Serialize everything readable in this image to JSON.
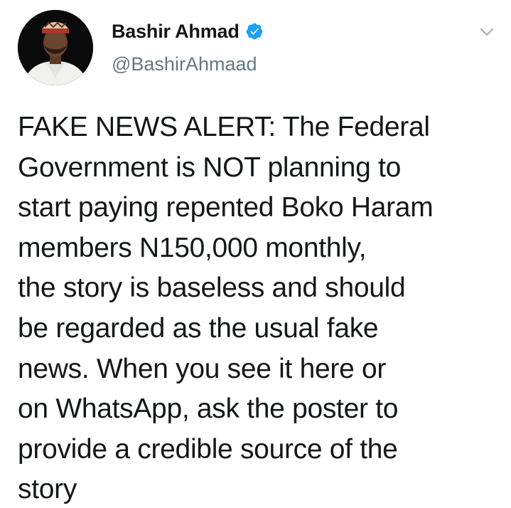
{
  "author": {
    "name": "Bashir Ahmad",
    "handle": "@BashirAhmaad",
    "verified": true,
    "avatar_icon": "profile-photo"
  },
  "menu_icon": "chevron-down-icon",
  "colors": {
    "text": "#14171a",
    "secondary": "#657786",
    "verified": "#1da1f2"
  },
  "tweet": {
    "lines": [
      "FAKE NEWS ALERT: The Federal",
      "Government is NOT planning to",
      "start paying repented Boko Haram",
      "members N150,000 monthly,",
      "the story is baseless and should",
      "be regarded as the usual fake",
      "news. When you see it here or",
      "on WhatsApp, ask the poster to",
      "provide a credible source of the",
      "story"
    ]
  }
}
